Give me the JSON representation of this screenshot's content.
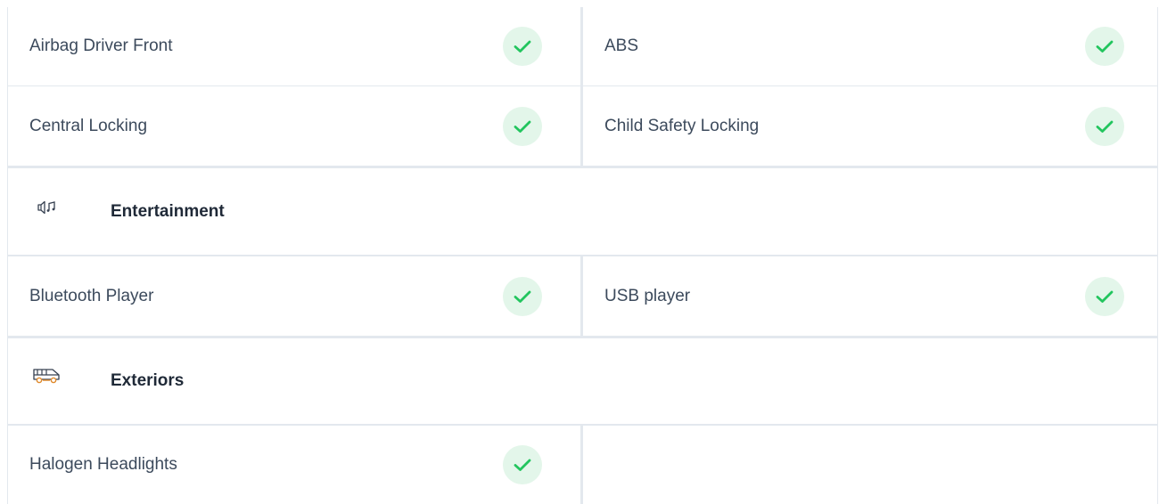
{
  "sections": [
    {
      "rows": [
        [
          {
            "label": "Airbag Driver Front",
            "available": true
          },
          {
            "label": "ABS",
            "available": true
          }
        ],
        [
          {
            "label": "Central Locking",
            "available": true
          },
          {
            "label": "Child Safety Locking",
            "available": true
          }
        ]
      ]
    },
    {
      "title": "Entertainment",
      "icon": "speaker-music-icon",
      "rows": [
        [
          {
            "label": "Bluetooth Player",
            "available": true
          },
          {
            "label": "USB player",
            "available": true
          }
        ]
      ]
    },
    {
      "title": "Exteriors",
      "icon": "car-icon",
      "rows": [
        [
          {
            "label": "Halogen Headlights",
            "available": true
          }
        ]
      ]
    }
  ],
  "colors": {
    "check_bg": "#e3f6ea",
    "check_mark": "#22c55e",
    "divider": "#e3e8ee",
    "icon_accent": "#e08a2b"
  }
}
